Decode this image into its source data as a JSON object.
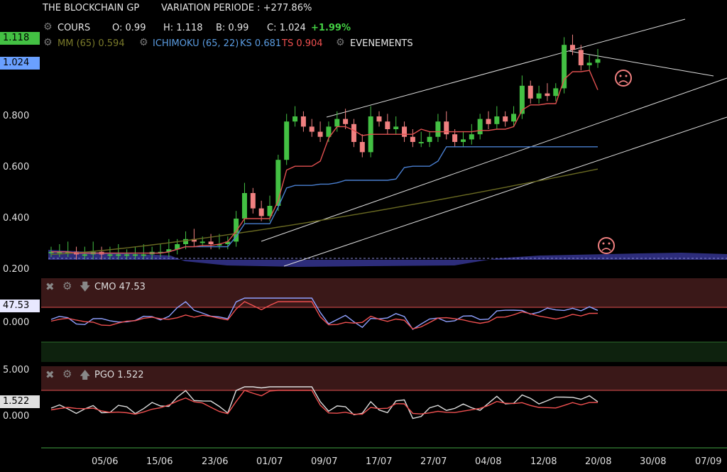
{
  "header": {
    "title": "THE BLOCKCHAIN GP",
    "variation": "VARIATION PERIODE : +277.86%",
    "cours_label": "COURS",
    "open": "O: 0.99",
    "high": "H: 1.118",
    "low": "B: 0.99",
    "close": "C: 1.024",
    "change": "+1.99%",
    "mm": "MM (65) 0.594",
    "ichimoku": "ICHIMOKU (65, 22)",
    "ks": "KS 0.681",
    "ts": "TS 0.904",
    "events": "EVENEMENTS"
  },
  "price_tags": {
    "high": "1.118",
    "last": "1.024"
  },
  "price_axis": [
    "0.800",
    "0.600",
    "0.400",
    "0.200"
  ],
  "cmo": {
    "label": "CMO 47.53",
    "tag": "47.53",
    "axis": "0.000"
  },
  "pgo": {
    "label": "PGO 1.522",
    "tag": "1.522",
    "axis_top": "5.000",
    "axis_zero": "0.000"
  },
  "x_dates": [
    "05/06",
    "15/06",
    "23/06",
    "01/07",
    "09/07",
    "17/07",
    "27/07",
    "04/08",
    "12/08",
    "20/08",
    "30/08",
    "07/09"
  ],
  "colors": {
    "up": "#43c043",
    "down": "#f08080",
    "mm": "#5a5a20",
    "ks": "#4a7fd0",
    "ts": "#e05050",
    "cloud": "#3a3a8a",
    "tag_high": "#43c043",
    "tag_last": "#6aa0ff",
    "ob": "#3a1a1a",
    "os": "#102010"
  },
  "chart_data": [
    {
      "type": "candlestick",
      "title": "THE BLOCKCHAIN GP",
      "x": [
        "05/06",
        "15/06",
        "23/06",
        "01/07",
        "09/07",
        "17/07",
        "27/07",
        "04/08",
        "12/08",
        "20/08"
      ],
      "ylim": [
        0.2,
        1.12
      ],
      "closes": [
        0.27,
        0.27,
        0.27,
        0.26,
        0.26,
        0.27,
        0.26,
        0.26,
        0.26,
        0.26,
        0.26,
        0.26,
        0.27,
        0.27,
        0.28,
        0.3,
        0.32,
        0.31,
        0.31,
        0.3,
        0.3,
        0.31,
        0.4,
        0.5,
        0.44,
        0.41,
        0.45,
        0.63,
        0.78,
        0.8,
        0.76,
        0.74,
        0.72,
        0.76,
        0.79,
        0.77,
        0.7,
        0.66,
        0.8,
        0.78,
        0.75,
        0.76,
        0.72,
        0.7,
        0.7,
        0.72,
        0.78,
        0.73,
        0.7,
        0.71,
        0.73,
        0.79,
        0.77,
        0.8,
        0.78,
        0.81,
        0.92,
        0.87,
        0.89,
        0.88,
        0.91,
        1.08,
        1.06,
        1.0,
        1.01,
        1.024
      ],
      "ichimoku_ts": 0.904,
      "kijun_ks": 0.681,
      "mm65": 0.594
    },
    {
      "type": "line",
      "name": "CMO",
      "last": 47.53
    },
    {
      "type": "line",
      "name": "PGO",
      "last": 1.522,
      "ylim_top": 5.0
    }
  ]
}
